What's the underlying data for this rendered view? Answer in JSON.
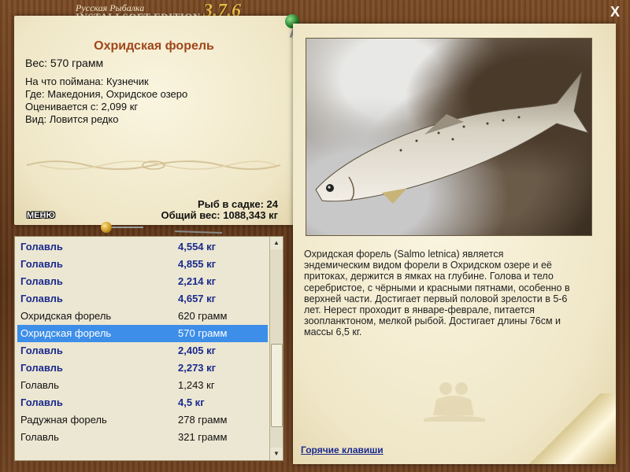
{
  "app": {
    "brand_line1": "Русская Рыбалка",
    "brand_line2": "INSTALLSOFT EDITION",
    "version": "3.7.6",
    "close_glyph": "X"
  },
  "fish": {
    "name": "Охридская форель",
    "weight": "Вес: 570 грамм",
    "bait": "На что поймана: Кузнечик",
    "place": "Где: Македония, Охридское озеро",
    "score": "Оценивается с: 2,099 кг",
    "kind": "Вид: Ловится редко"
  },
  "keep": {
    "count": "Рыб в садке: 24",
    "total": "Общий вес: 1088,343 кг"
  },
  "menu_label": "МЕНЮ",
  "catch_list": [
    {
      "name": "Голавль",
      "weight": "4,554 кг",
      "bold": true,
      "selected": false
    },
    {
      "name": "Голавль",
      "weight": "4,855 кг",
      "bold": true,
      "selected": false
    },
    {
      "name": "Голавль",
      "weight": "2,214 кг",
      "bold": true,
      "selected": false
    },
    {
      "name": "Голавль",
      "weight": "4,657 кг",
      "bold": true,
      "selected": false
    },
    {
      "name": "Охридская форель",
      "weight": "620 грамм",
      "bold": false,
      "selected": false
    },
    {
      "name": "Охридская форель",
      "weight": "570 грамм",
      "bold": false,
      "selected": true
    },
    {
      "name": "Голавль",
      "weight": "2,405 кг",
      "bold": true,
      "selected": false
    },
    {
      "name": "Голавль",
      "weight": "2,273 кг",
      "bold": true,
      "selected": false
    },
    {
      "name": "Голавль",
      "weight": "1,243 кг",
      "bold": false,
      "selected": false
    },
    {
      "name": "Голавль",
      "weight": "4,5 кг",
      "bold": true,
      "selected": false
    },
    {
      "name": "Радужная форель",
      "weight": "278 грамм",
      "bold": false,
      "selected": false
    },
    {
      "name": "Голавль",
      "weight": "321 грамм",
      "bold": false,
      "selected": false
    }
  ],
  "description": "Охридская форель (Salmo letnica) является эндемическим видом форели в Охридском озере и её притоках, держится в ямках на глубине. Голова и тело серебристое, с чёрными и красными пятнами, особенно в верхней части. Достигает первый половой зрелости в 5-6 лет. Нерест проходит в январе-феврале, питается зоопланктоном, мелкой рыбой. Достигает длины 76см и массы 6,5 кг.",
  "hotkeys_label": "Горячие клавиши",
  "colors": {
    "fish_name": "#a0461a",
    "bold_row": "#1a2a8e",
    "selected_row": "#3d8ee8",
    "version": "#e8b84a"
  }
}
